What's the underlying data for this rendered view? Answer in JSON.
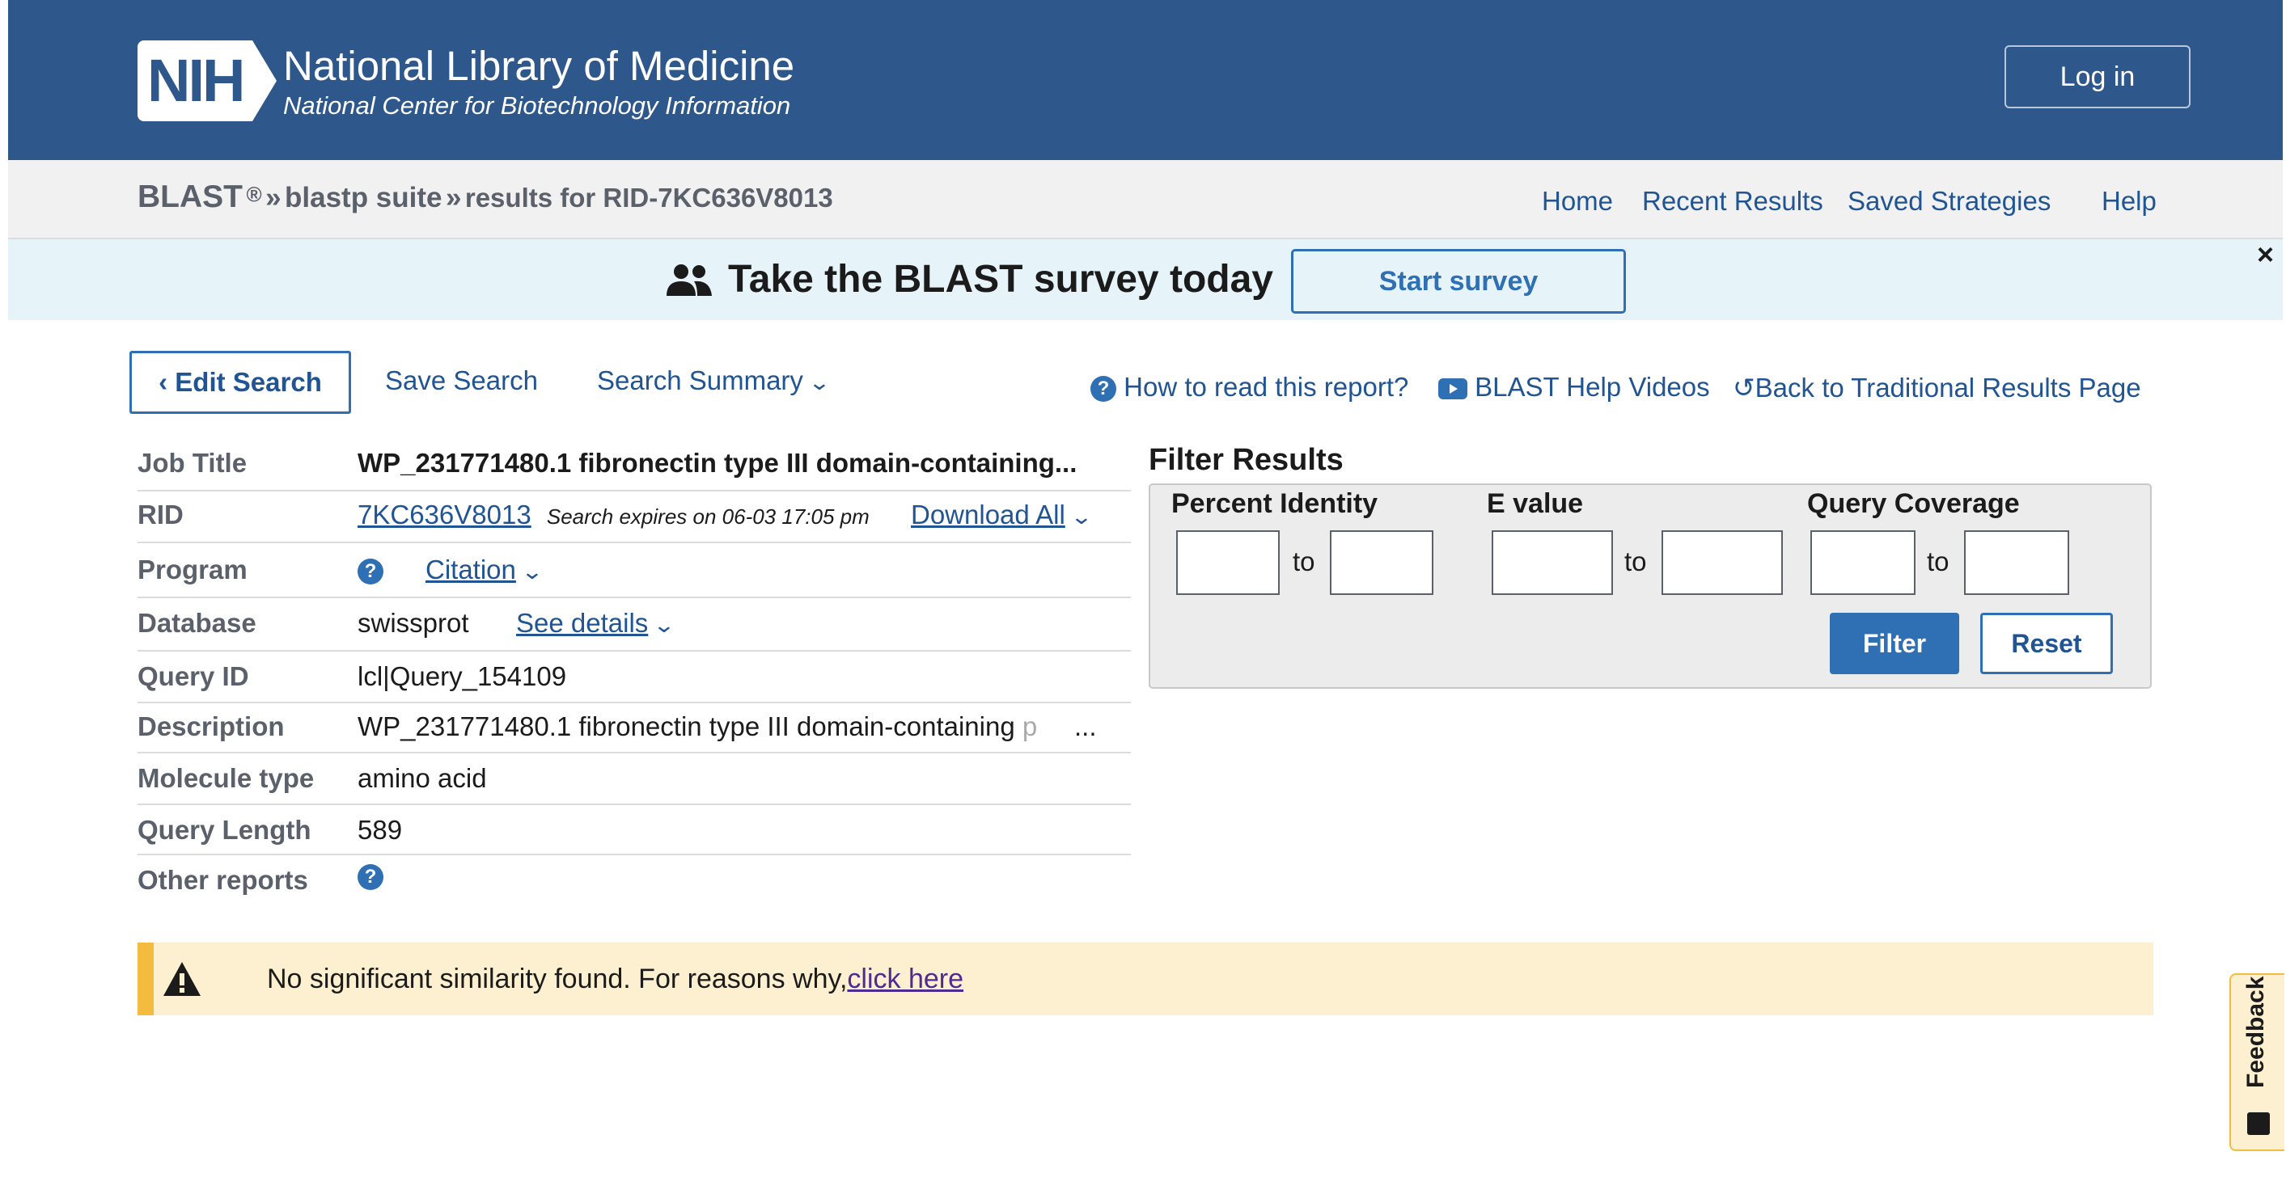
{
  "header": {
    "logo_text": "NIH",
    "title": "National Library of Medicine",
    "subtitle": "National Center for Biotechnology Information",
    "login_label": "Log in"
  },
  "breadcrumb": {
    "root": "BLAST",
    "root_mark": "®",
    "sep": "»",
    "suite": "blastp suite",
    "results": "results for RID-7KC636V8013"
  },
  "nav": {
    "home": "Home",
    "recent": "Recent Results",
    "saved": "Saved Strategies",
    "help": "Help"
  },
  "survey": {
    "text": "Take the BLAST survey today",
    "button": "Start survey",
    "close": "×"
  },
  "toolbar": {
    "edit_search": "Edit Search",
    "save_search": "Save Search",
    "search_summary": "Search Summary",
    "how_to_read": "How to read this report?",
    "help_videos": "BLAST Help Videos",
    "back_traditional": "Back to Traditional Results Page"
  },
  "info": {
    "job_title_label": "Job Title",
    "job_title": "WP_231771480.1 fibronectin type III domain-containing...",
    "rid_label": "RID",
    "rid": "7KC636V8013",
    "expires": "Search expires on 06-03 17:05 pm",
    "download_all": "Download All",
    "program_label": "Program",
    "citation": "Citation",
    "database_label": "Database",
    "database": "swissprot",
    "see_details": "See details",
    "query_id_label": "Query ID",
    "query_id": "lcl|Query_154109",
    "description_label": "Description",
    "description": "WP_231771480.1 fibronectin type III domain-containing ",
    "description_fade": "p",
    "description_more": "...",
    "molecule_label": "Molecule type",
    "molecule": "amino acid",
    "length_label": "Query Length",
    "length": "589",
    "other_label": "Other reports"
  },
  "filter": {
    "title": "Filter Results",
    "percent_identity": "Percent Identity",
    "e_value": "E value",
    "query_coverage": "Query Coverage",
    "to": "to",
    "filter_btn": "Filter",
    "reset_btn": "Reset"
  },
  "alert": {
    "text": "No significant similarity found. For reasons why,",
    "link": "click here"
  },
  "feedback": {
    "label": "Feedback"
  },
  "colors": {
    "header_bg": "#2e578c",
    "link": "#205493",
    "button_blue": "#2f6fb3",
    "alert_bg": "#fcf0d0",
    "alert_bar": "#f3bc3e"
  }
}
